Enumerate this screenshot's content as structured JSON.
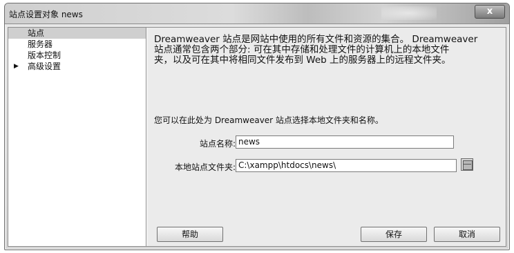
{
  "window": {
    "title": "站点设置对象 news",
    "close_label": "x"
  },
  "sidebar": {
    "items": [
      {
        "label": "站点",
        "selected": true
      },
      {
        "label": "服务器"
      },
      {
        "label": "版本控制"
      },
      {
        "label": "高级设置",
        "expandable": true
      }
    ]
  },
  "main": {
    "description_lines": [
      "Dreamweaver 站点是网站中使用的所有文件和资源的集合。 Dreamweaver",
      "站点通常包含两个部分: 可在其中存储和处理文件的计算机上的本地文件",
      "夹，以及可在其中将相同文件发布到 Web 上的服务器上的远程文件夹。"
    ],
    "subdescription": "您可以在此处为 Dreamweaver 站点选择本地文件夹和名称。",
    "site_name_label": "站点名称:",
    "site_name_value": "news",
    "local_folder_label": "本地站点文件夹:",
    "local_folder_value": "C:\\xampp\\htdocs\\news\\"
  },
  "buttons": {
    "help": "帮助",
    "save": "保存",
    "cancel": "取消"
  }
}
